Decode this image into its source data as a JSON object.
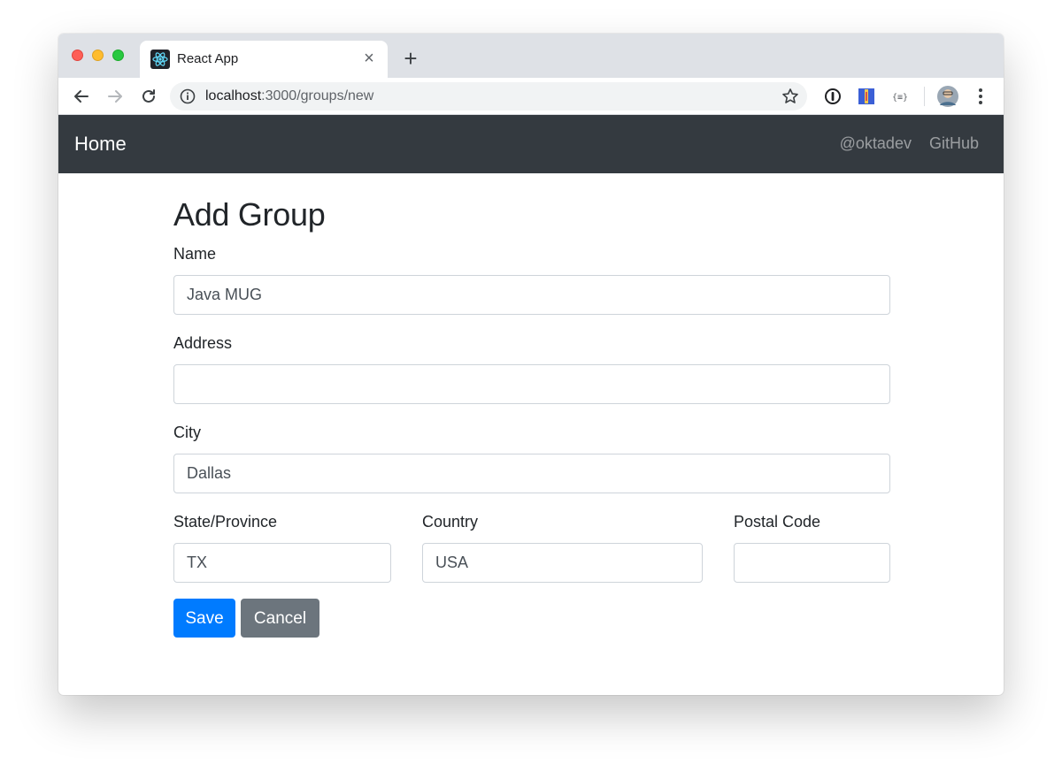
{
  "browser": {
    "tab_title": "React App",
    "tab_close": "×",
    "new_tab": "+",
    "url_host": "localhost",
    "url_path": ":3000/groups/new"
  },
  "navbar": {
    "brand": "Home",
    "links": [
      "@oktadev",
      "GitHub"
    ],
    "background": "#343a40"
  },
  "form": {
    "title": "Add Group",
    "fields": {
      "name": {
        "label": "Name",
        "value": "Java MUG"
      },
      "address": {
        "label": "Address",
        "value": ""
      },
      "city": {
        "label": "City",
        "value": "Dallas"
      },
      "state": {
        "label": "State/Province",
        "value": "TX"
      },
      "country": {
        "label": "Country",
        "value": "USA"
      },
      "postal": {
        "label": "Postal Code",
        "value": ""
      }
    },
    "save_label": "Save",
    "cancel_label": "Cancel"
  },
  "colors": {
    "primary": "#007bff",
    "secondary": "#6c757d"
  },
  "icons": [
    "react-logo-icon",
    "back-arrow-icon",
    "forward-arrow-icon",
    "reload-icon",
    "info-icon",
    "bookmark-star-icon",
    "password-manager-icon",
    "extension-icon",
    "json-viewer-icon",
    "profile-avatar-icon",
    "menu-dots-icon"
  ]
}
